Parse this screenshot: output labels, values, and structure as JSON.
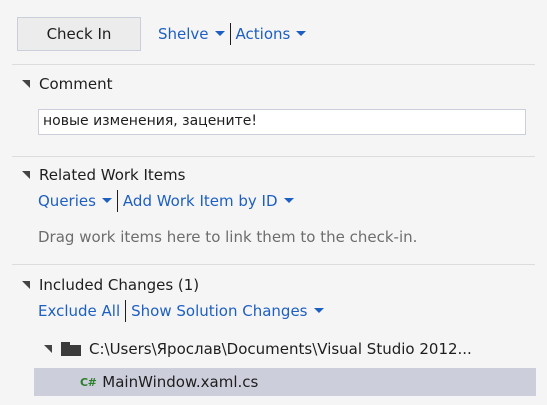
{
  "toolbar": {
    "checkin_label": "Check In",
    "shelve_label": "Shelve",
    "actions_label": "Actions"
  },
  "comment": {
    "title": "Comment",
    "value": "новые изменения, заценитe!"
  },
  "related": {
    "title": "Related Work Items",
    "queries_label": "Queries",
    "add_label": "Add Work Item by ID",
    "hint": "Drag work items here to link them to the check-in."
  },
  "included": {
    "title": "Included Changes (1)",
    "exclude_all_label": "Exclude All",
    "show_solution_label": "Show Solution Changes",
    "folder_path": "C:\\Users\\Ярослав\\Documents\\Visual Studio 2012...",
    "file_icon_text": "C#",
    "file_name": "MainWindow.xaml.cs"
  },
  "icons": {
    "expand": "expanded-triangle-icon",
    "dropdown": "chevron-down-icon",
    "folder": "folder-icon",
    "csharp": "csharp-file-icon"
  },
  "colors": {
    "link": "#1e5fc2",
    "selection": "#cccedb",
    "background": "#f5f5f5"
  }
}
